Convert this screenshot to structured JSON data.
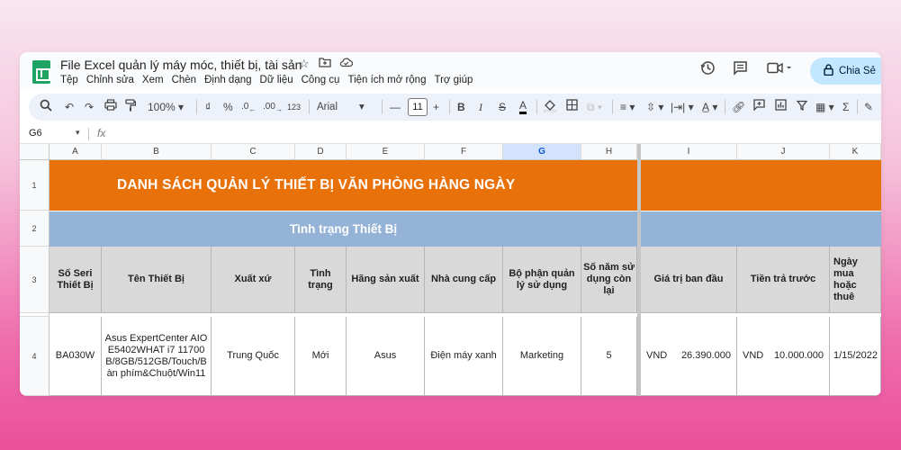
{
  "app": {
    "doc_title": "File Excel quản lý máy móc, thiết bị, tài sản",
    "menu": [
      "Tệp",
      "Chỉnh sửa",
      "Xem",
      "Chèn",
      "Định dạng",
      "Dữ liệu",
      "Công cụ",
      "Tiện ích mở rộng",
      "Trợ giúp"
    ],
    "share_label": "Chia Sẻ",
    "icons": {
      "star": "★",
      "folder": "folder-icon",
      "cloud": "cloud-icon",
      "history": "history-icon",
      "comment": "comment-icon",
      "meet": "video-icon",
      "lock": "lock-icon"
    }
  },
  "toolbar": {
    "zoom": "100%",
    "currency": "₫",
    "percent": "%",
    "dec_dec": ".0",
    "dec_inc": ".00",
    "format_123": "123",
    "font": "Arial",
    "font_size": "11",
    "minus": "—",
    "plus": "+",
    "bold": "B",
    "italic": "I",
    "strike": "S",
    "text_color": "A"
  },
  "formula_bar": {
    "name_box": "G6",
    "fx": "fx",
    "value": ""
  },
  "grid": {
    "columns": [
      "A",
      "B",
      "C",
      "D",
      "E",
      "F",
      "G",
      "H",
      "I",
      "J",
      "K"
    ],
    "selected_column": "G",
    "rows": [
      "1",
      "2",
      "3",
      "4"
    ],
    "title": "DANH SÁCH QUẢN LÝ THIẾT BỊ VĂN PHÒNG HÀNG NGÀY",
    "subtitle": "Tình trạng Thiết Bị",
    "headers": [
      "Số Seri Thiết Bị",
      "Tên Thiết Bị",
      "Xuất xứ",
      "Tình trạng",
      "Hãng sản xuất",
      "Nhà cung cấp",
      "Bộ phận quản lý sử dụng",
      "Số năm sử dụng còn lại",
      "Giá trị ban đầu",
      "Tiền trả trước",
      "Ngày mua hoặc thuê"
    ],
    "row4": {
      "serial": "BA030W",
      "name": "Asus ExpertCenter AIO E5402WHAT i7 11700B/8GB/512GB/Touch/Bàn phím&Chuột/Win11",
      "origin": "Trung Quốc",
      "status": "Mới",
      "maker": "Asus",
      "supplier": "Điện máy xanh",
      "department": "Marketing",
      "years_left": "5",
      "initial_currency": "VND",
      "initial_value": "26.390.000",
      "prepaid_currency": "VND",
      "prepaid_value": "10.000.000",
      "purchase_date": "1/15/2022"
    }
  },
  "colors": {
    "title_band": "#e8710a",
    "subtitle_band": "#95b3d7",
    "header_fill": "#d9d9d9",
    "share_button": "#c2e7ff"
  }
}
